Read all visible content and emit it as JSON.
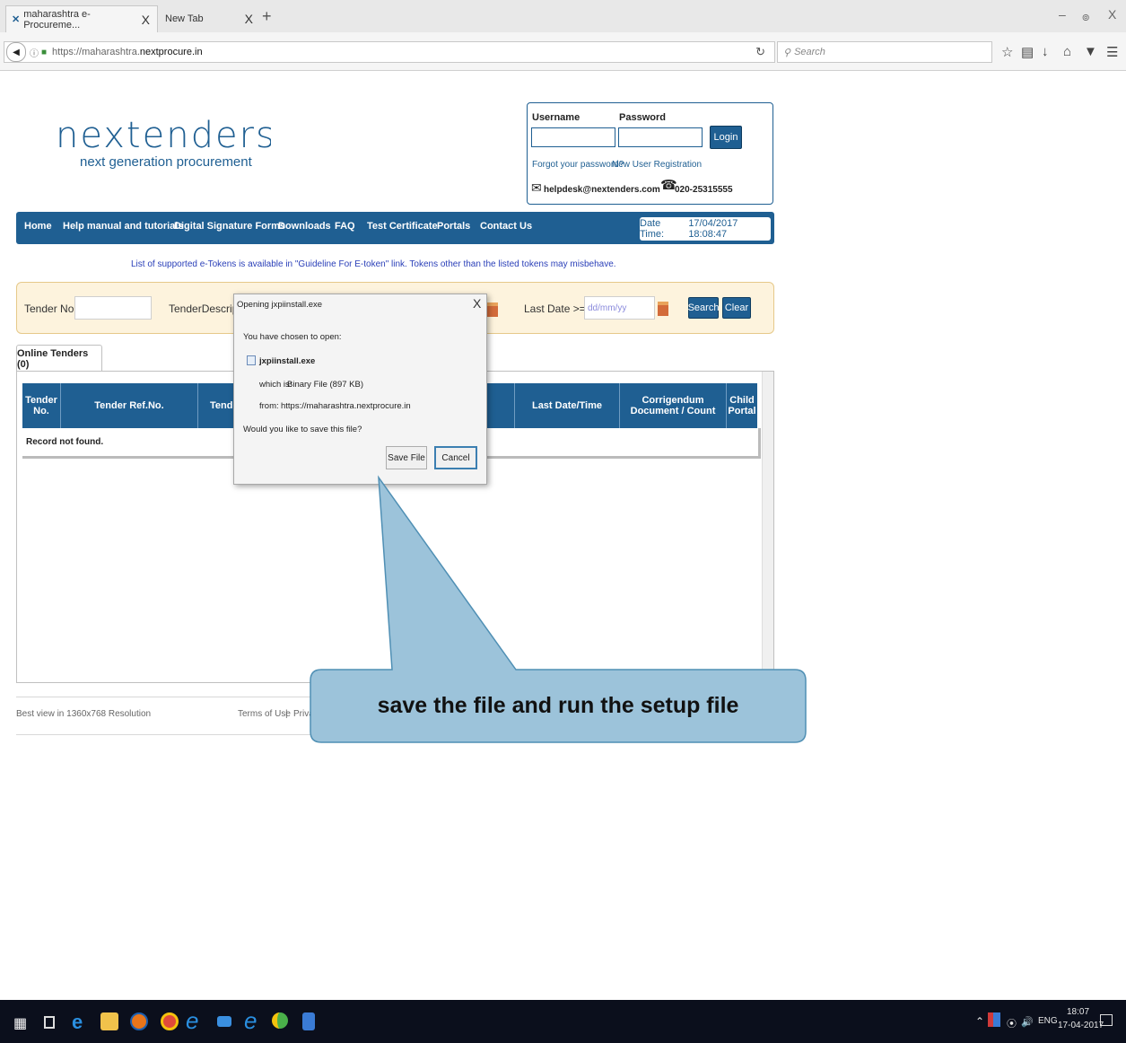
{
  "browser": {
    "tabs": [
      {
        "title": "maharashtra e-Procureme...",
        "close": "X"
      },
      {
        "title": "New Tab",
        "close": "X"
      }
    ],
    "new_tab": "+",
    "window_controls": {
      "minimize": "–",
      "restore": "๏",
      "close": "X"
    },
    "url_prefix": "https://maharashtra.",
    "url_domain": "nextprocure.in",
    "search_placeholder": "Search",
    "icons": [
      "back-icon",
      "info-icon",
      "lock-icon",
      "reload-icon",
      "search-icon",
      "bookmark-star-icon",
      "reading-list-icon",
      "download-icon",
      "home-icon",
      "pocket-icon",
      "menu-icon"
    ]
  },
  "site": {
    "logo": "nextenders",
    "tagline": "next generation procurement",
    "login": {
      "username_label": "Username",
      "password_label": "Password",
      "login_button": "Login",
      "forgot_link": "Forgot your password?",
      "register_link": "New User Registration",
      "helpdesk_email": "helpdesk@nextenders.com",
      "helpdesk_phone": "020-25315555"
    },
    "nav": [
      "Home",
      "Help manual and tutorials",
      "Digital Signature Forms",
      "Downloads",
      "FAQ",
      "Test Certificate",
      "Portals",
      "Contact Us"
    ],
    "datetime_label": "Date Time:",
    "datetime_value": "17/04/2017 18:08:47",
    "etoken_notice": "List of supported e-Tokens is available in \"Guideline For E-token\" link. Tokens other than the listed tokens may misbehave.",
    "search": {
      "tender_no_label": "Tender No.",
      "description_label": "TenderDescription",
      "last_date_label": "Last Date >=",
      "last_date_placeholder": "dd/mm/yy",
      "search_button": "Search",
      "clear_button": "Clear"
    },
    "tab_label": "Online Tenders (0)",
    "table": {
      "headers": [
        "Tender No.",
        "Tender Ref.No.",
        "Tende",
        "Last Date/Time",
        "Corrigendum Document / Count",
        "Child Portal"
      ],
      "empty_message": "Record not found."
    },
    "footer": {
      "resolution_note": "Best view in 1360x768 Resolution",
      "terms": "Terms of Use",
      "separator": "|",
      "privacy": "Priva"
    }
  },
  "dialog": {
    "title": "Opening jxpiinstall.exe",
    "close": "X",
    "chosen_text": "You have chosen to open:",
    "filename": "jxpiinstall.exe",
    "which_is_label": "which is:",
    "which_is_value": "Binary File (897 KB)",
    "from_label": "from:",
    "from_value": "https://maharashtra.nextprocure.in",
    "question": "Would you like to save this file?",
    "save_button": "Save File",
    "cancel_button": "Cancel"
  },
  "callout": {
    "text": "save the file and run the setup file",
    "fill": "#9cc3da",
    "border": "#4f8fb4"
  },
  "taskbar": {
    "apps": [
      "windows-start-icon",
      "task-view-icon",
      "edge-icon",
      "file-explorer-icon",
      "firefox-icon",
      "chrome-icon",
      "ie-icon",
      "mail-icon",
      "edge-alt-icon",
      "app-icon",
      "store-icon"
    ],
    "language": "ENG",
    "time": "18:07",
    "date": "17-04-2017"
  }
}
